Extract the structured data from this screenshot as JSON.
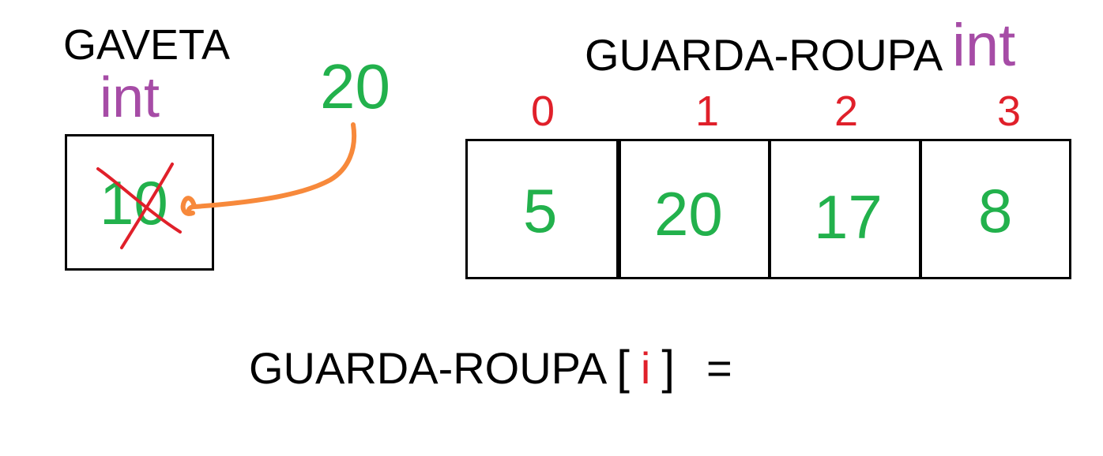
{
  "colors": {
    "purple": "#a64ca6",
    "green": "#22b14c",
    "red": "#e0202a",
    "orange": "#f7893b",
    "black": "#000000"
  },
  "gaveta": {
    "title": "GAVETA",
    "type": "int",
    "old_value": "10",
    "old_value_crossed_out": true,
    "incoming_value": "20"
  },
  "guarda_roupa": {
    "title": "GUARDA-ROUPA",
    "type": "int",
    "cells": [
      {
        "index": "0",
        "value": "5"
      },
      {
        "index": "1",
        "value": "20"
      },
      {
        "index": "2",
        "value": "17"
      },
      {
        "index": "3",
        "value": "8"
      }
    ]
  },
  "expression": {
    "name": "GUARDA-ROUPA",
    "open_bracket": "[",
    "index_var": "i",
    "close_bracket": "]",
    "equals": "="
  }
}
